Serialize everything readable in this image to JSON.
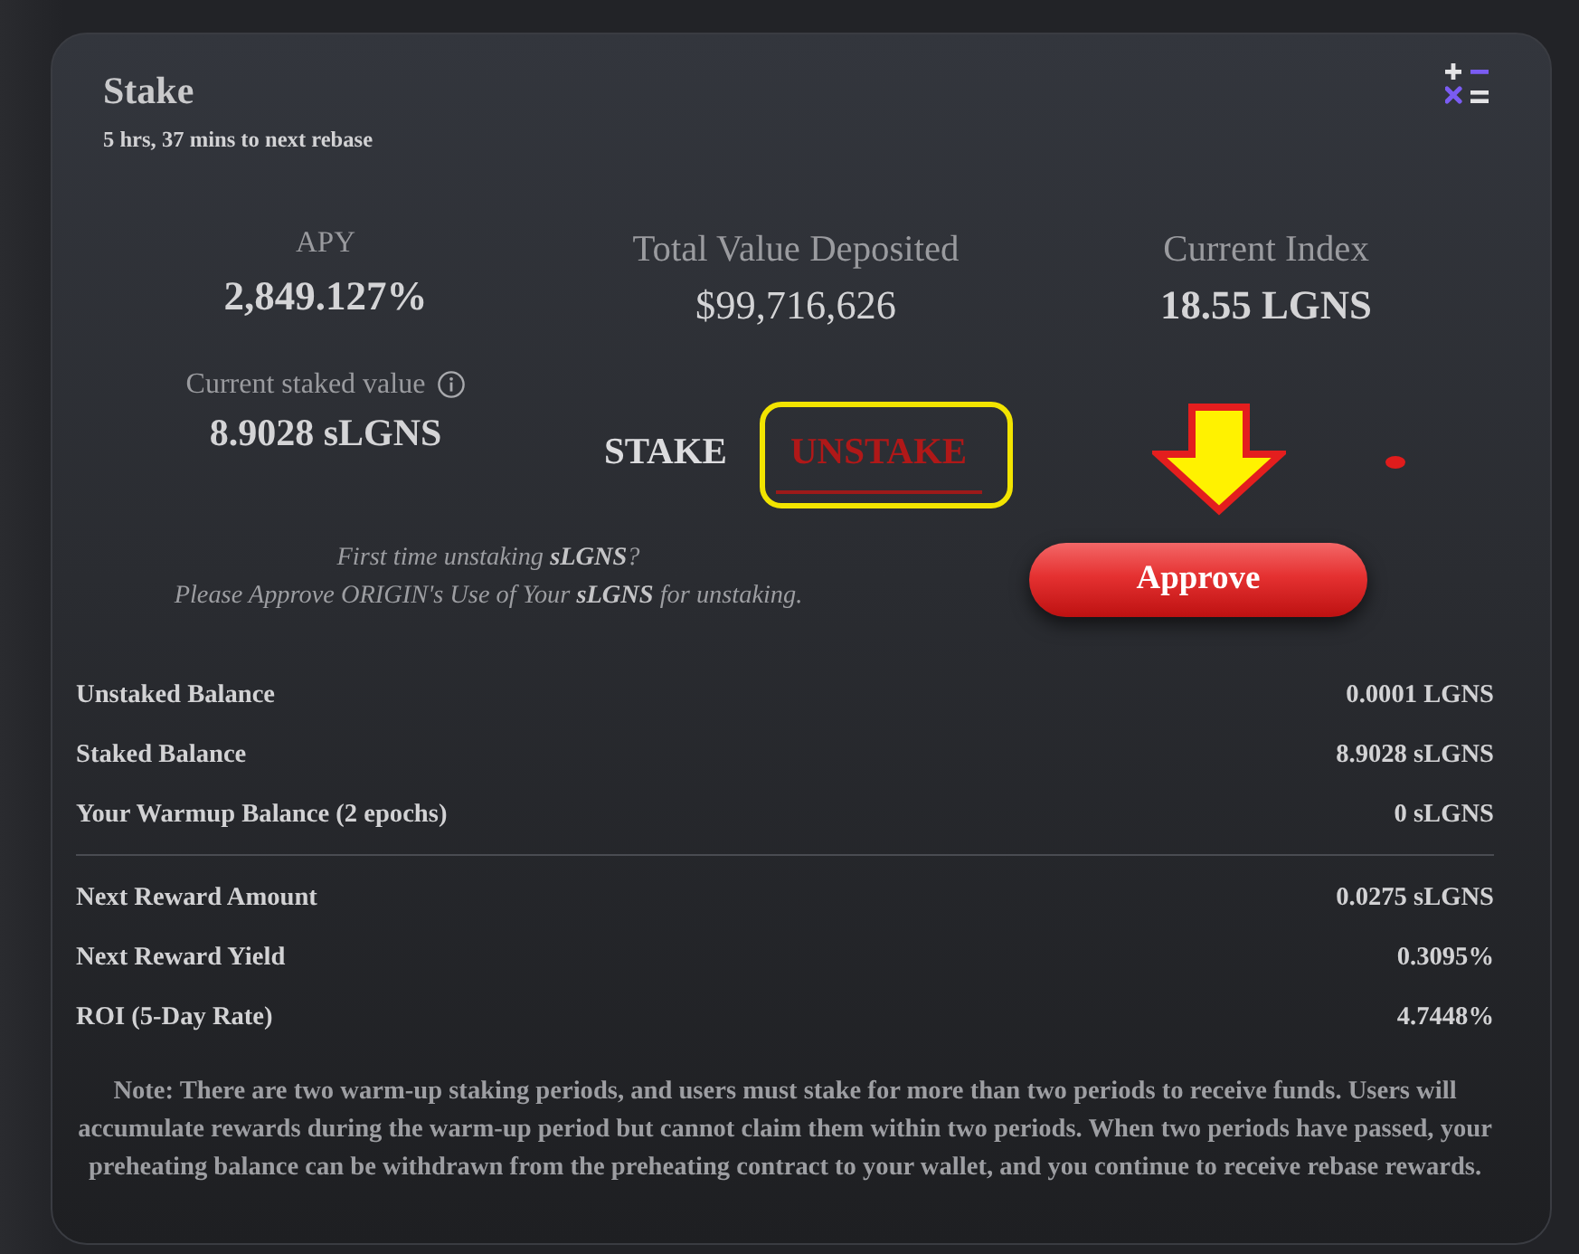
{
  "stake_card": {
    "title": "Stake",
    "rebase_timer": "5 hrs, 37 mins to next rebase"
  },
  "apy": {
    "label": "APY",
    "value": "2,849.127%"
  },
  "total_value_deposited": {
    "label": "Total Value Deposited",
    "value": "$99,716,626"
  },
  "current_index": {
    "label": "Current Index",
    "value": "18.55 LGNS"
  },
  "current_staked_value": {
    "label": "Current staked value",
    "value": "8.9028 sLGNS"
  },
  "tabs": [
    {
      "label": "STAKE",
      "selected": false
    },
    {
      "label": "UNSTAKE",
      "selected": true
    }
  ],
  "approve_hint": [
    "First time unstaking **sLGNS**?",
    "Please Approve ORIGIN's Use of Your **sLGNS** for unstaking."
  ],
  "approve_button": {
    "label": "Approve"
  },
  "balances": [
    {
      "label": "Unstaked Balance",
      "value": "0.0001 LGNS"
    },
    {
      "label": "Staked Balance",
      "value": "8.9028 sLGNS"
    },
    {
      "label": "Your Warmup Balance (2 epochs)",
      "value": "0 sLGNS"
    }
  ],
  "rewards": [
    {
      "label": "Next Reward Amount",
      "value": "0.0275 sLGNS"
    },
    {
      "label": "Next Reward Yield",
      "value": "0.3095%"
    },
    {
      "label": "ROI (5-Day Rate)",
      "value": "4.7448%"
    }
  ],
  "note": "Note: There are two warm-up staking periods, and users must stake for more than two periods to receive funds. Users will accumulate rewards during the warm-up period but cannot claim them within two periods. When two periods have passed, your preheating balance can be withdrawn from the preheating contract to your wallet, and you continue to receive rebase rewards."
}
